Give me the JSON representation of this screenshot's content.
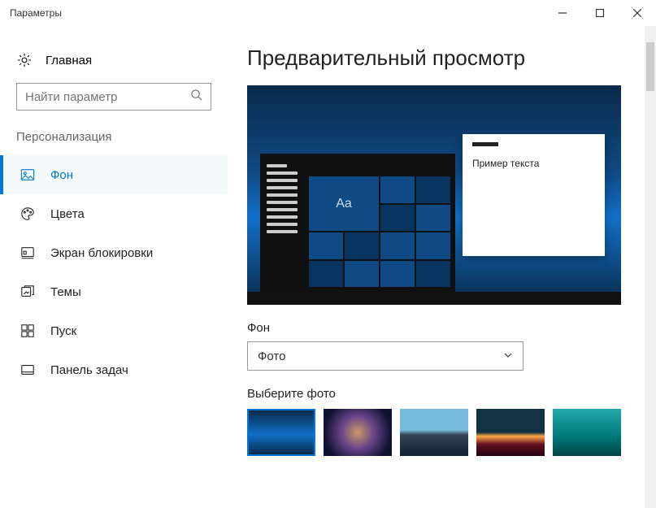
{
  "window": {
    "title": "Параметры"
  },
  "sidebar": {
    "home": "Главная",
    "search_placeholder": "Найти параметр",
    "group": "Персонализация",
    "items": [
      {
        "label": "Фон"
      },
      {
        "label": "Цвета"
      },
      {
        "label": "Экран блокировки"
      },
      {
        "label": "Темы"
      },
      {
        "label": "Пуск"
      },
      {
        "label": "Панель задач"
      }
    ]
  },
  "content": {
    "title": "Предварительный просмотр",
    "preview": {
      "tile_text": "Aa",
      "sample_text": "Пример текста"
    },
    "background_label": "Фон",
    "dropdown_value": "Фото",
    "choose_label": "Выберите фото"
  }
}
